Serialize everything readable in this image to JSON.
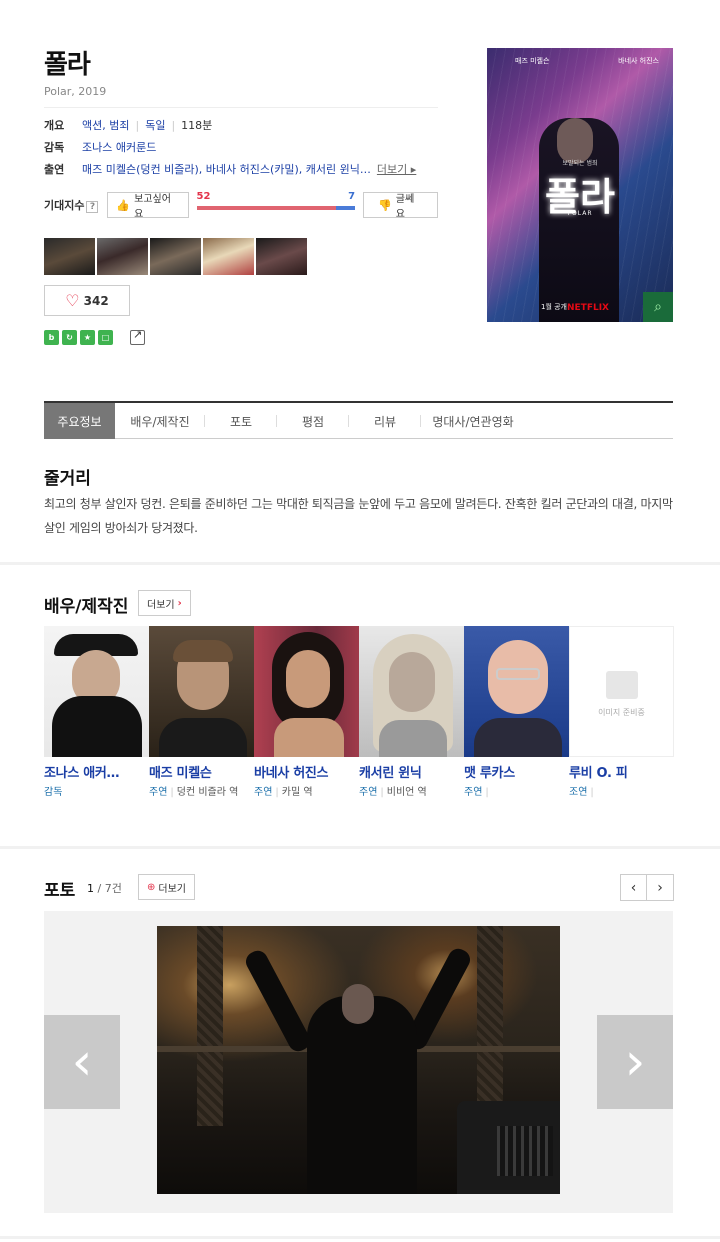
{
  "movie": {
    "title": "폴라",
    "subtitle": "Polar, 2019",
    "overview": {
      "label": "개요",
      "genre": "액션, 범죄",
      "country": "독일",
      "runtime": "118분"
    },
    "director": {
      "label": "감독",
      "name": "조나스 애커룬드"
    },
    "cast": {
      "label": "출연",
      "text": "매즈 미켈슨(덩컨 비즐라), 바네사 허진스(카밀), 캐서린 윈닉…",
      "more": "더보기 ▸"
    }
  },
  "expect": {
    "label": "기대지수",
    "help": "?",
    "want_label": "보고싶어요",
    "want_count": "52",
    "notwant_count": "7",
    "notwant_label": "글쎄요",
    "want_ratio": 0.881
  },
  "like": {
    "count": "342"
  },
  "share_icons": [
    "blog-icon",
    "naver-icon",
    "star-icon",
    "green-square-icon",
    "share-icon"
  ],
  "poster": {
    "actor_left": "매즈 미켈슨",
    "actor_right": "바네사 허진스",
    "title": "폴라",
    "tagline": "보말되는 범죄",
    "en_title": "POLAR",
    "release": "1월 공개",
    "brand": "NETFLIX"
  },
  "tabs": [
    {
      "label": "주요정보",
      "active": true
    },
    {
      "label": "배우/제작진"
    },
    {
      "label": "포토"
    },
    {
      "label": "평점"
    },
    {
      "label": "리뷰"
    },
    {
      "label": "명대사/연관영화"
    }
  ],
  "synopsis": {
    "title": "줄거리",
    "text": "최고의 청부 살인자 덩컨. 은퇴를 준비하던 그는 막대한 퇴직금을 눈앞에 두고 음모에 말려든다. 잔혹한 킬러 군단과의 대결, 마지막 살인 게임의 방아쇠가 당겨졌다."
  },
  "cast_section": {
    "title": "배우/제작진",
    "more": "더보기",
    "people": [
      {
        "name": "조나스 애커…",
        "role": "감독",
        "character": ""
      },
      {
        "name": "매즈 미켈슨",
        "role": "주연",
        "character": "덩컨 비즐라 역"
      },
      {
        "name": "바네사 허진스",
        "role": "주연",
        "character": "카밀 역"
      },
      {
        "name": "캐서린 윈닉",
        "role": "주연",
        "character": "비비언 역"
      },
      {
        "name": "맷 루카스",
        "role": "주연",
        "character": ""
      },
      {
        "name": "루비 O. 피",
        "role": "조연",
        "character": ""
      }
    ],
    "placeholder_text": "이미지 준비중"
  },
  "photo_section": {
    "title": "포토",
    "current": "1",
    "total": "/ 7건",
    "more": "더보기"
  },
  "colors": {
    "accent_blue": "#1a3ea5",
    "accent_red": "#e3344b",
    "tab_active": "#777777"
  }
}
